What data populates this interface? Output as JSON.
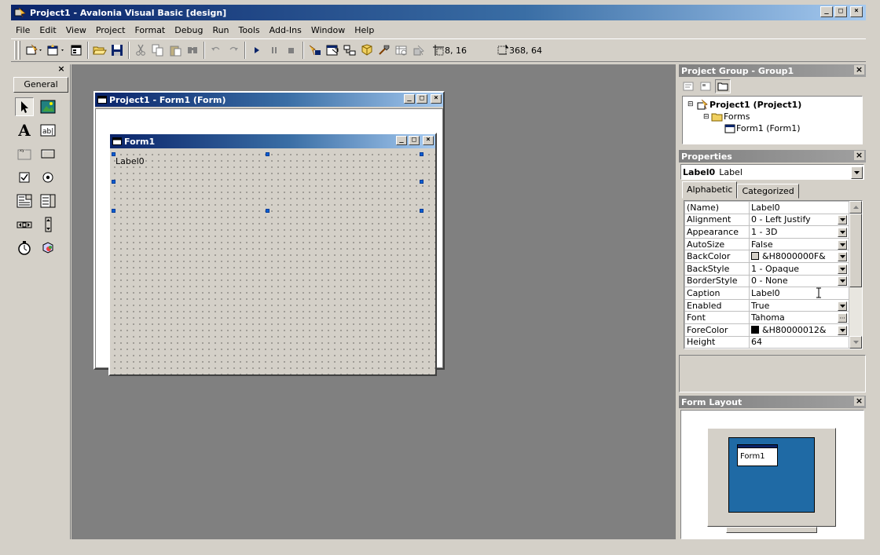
{
  "window": {
    "title": "Project1 - Avalonia Visual Basic [design]",
    "minimize": "_",
    "maximize": "□",
    "close": "×"
  },
  "menu": [
    "File",
    "Edit",
    "View",
    "Project",
    "Format",
    "Debug",
    "Run",
    "Tools",
    "Add-Ins",
    "Window",
    "Help"
  ],
  "toolbar": {
    "position_readout": "8, 16",
    "size_readout": "368, 64"
  },
  "toolbox": {
    "close": "×",
    "tab_label": "General"
  },
  "designer": {
    "title": "Project1 - Form1 (Form)",
    "form_title": "Form1",
    "label_text": "Label0"
  },
  "project_group": {
    "title": "Project Group - Group1",
    "close": "×",
    "project_node": "Project1 (Project1)",
    "forms_node": "Forms",
    "form_node": "Form1 (Form1)"
  },
  "properties": {
    "title": "Properties",
    "close": "×",
    "object_name": "Label0",
    "object_type": "Label",
    "tabs": [
      "Alphabetic",
      "Categorized"
    ],
    "rows": [
      {
        "name": "(Name)",
        "value": "Label0",
        "button": ""
      },
      {
        "name": "Alignment",
        "value": "0 - Left Justify",
        "button": "dropdown"
      },
      {
        "name": "Appearance",
        "value": "1 - 3D",
        "button": "dropdown"
      },
      {
        "name": "AutoSize",
        "value": "False",
        "button": "dropdown"
      },
      {
        "name": "BackColor",
        "value": "&H8000000F&",
        "button": "dropdown",
        "swatch": "#d4d0c8"
      },
      {
        "name": "BackStyle",
        "value": "1 - Opaque",
        "button": "dropdown"
      },
      {
        "name": "BorderStyle",
        "value": "0 - None",
        "button": "dropdown"
      },
      {
        "name": "Caption",
        "value": "Label0",
        "button": ""
      },
      {
        "name": "Enabled",
        "value": "True",
        "button": "dropdown"
      },
      {
        "name": "Font",
        "value": "Tahoma",
        "button": "ellipsis"
      },
      {
        "name": "ForeColor",
        "value": "&H80000012&",
        "button": "dropdown",
        "swatch": "#000000"
      },
      {
        "name": "Height",
        "value": "64",
        "button": ""
      }
    ]
  },
  "form_layout": {
    "title": "Form Layout",
    "close": "×",
    "form_label": "Form1"
  },
  "colors": {
    "title_active": "#0a246a",
    "face": "#d4d0c8",
    "mdi": "#808080",
    "monitor_screen": "#1f6aa5",
    "handle": "#0a5fd0"
  }
}
